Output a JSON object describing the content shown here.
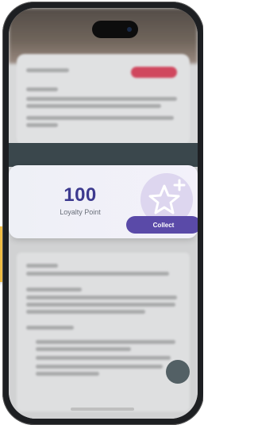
{
  "loyalty": {
    "points": "100",
    "label": "Loyalty Point",
    "collect_label": "Collect"
  },
  "icons": {
    "reward": "star-plus-icon"
  },
  "colors": {
    "accent": "#5a4aa8",
    "points": "#3d3a8f",
    "badge_bg": "#ddd6ef",
    "pill": "#e84a63"
  }
}
